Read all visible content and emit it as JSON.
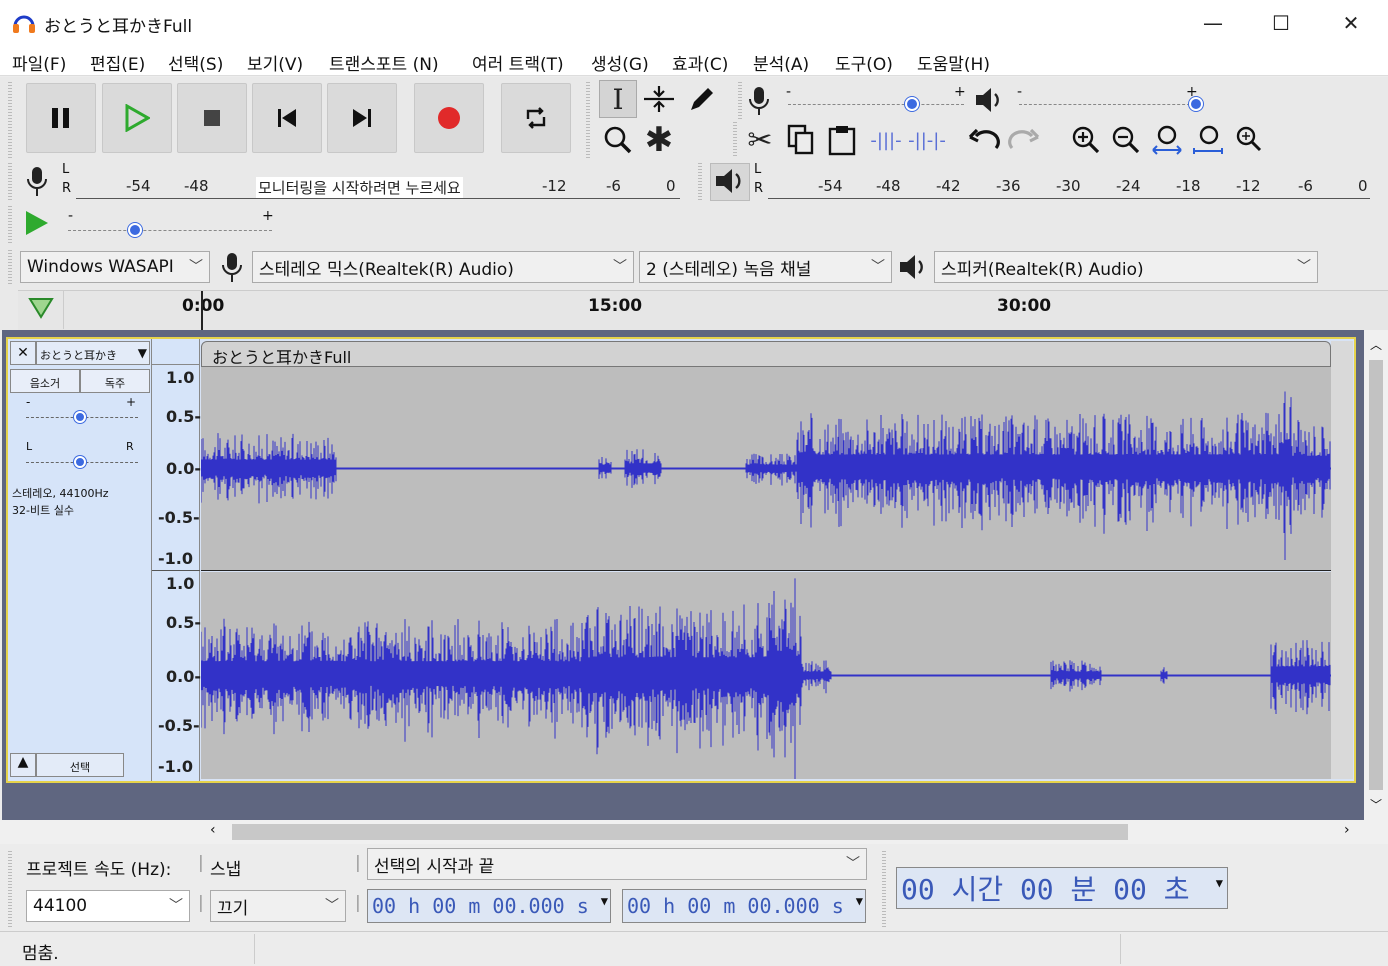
{
  "window": {
    "title": "おとうと耳かきFull",
    "minimize": "—",
    "maximize": "☐",
    "close": "✕"
  },
  "menu": [
    "파일(F)",
    "편집(E)",
    "선택(S)",
    "보기(V)",
    "트랜스포트 (N)",
    "여러 트랙(T)",
    "생성(G)",
    "효과(C)",
    "분석(A)",
    "도구(O)",
    "도움말(H)"
  ],
  "recording_meter": {
    "ticks": [
      "-54",
      "-48",
      "-12",
      "-6",
      "0"
    ],
    "prompt": "모니터링을 시작하려면 누르세요",
    "l": "L",
    "r": "R"
  },
  "playback_meter": {
    "ticks": [
      "-54",
      "-48",
      "-42",
      "-36",
      "-30",
      "-24",
      "-18",
      "-12",
      "-6",
      "0"
    ],
    "l": "L",
    "r": "R"
  },
  "slider_labels": {
    "minus": "-",
    "plus": "+"
  },
  "device": {
    "host": "Windows WASAPI",
    "input": "스테레오 믹스(Realtek(R) Audio)",
    "channels": "2 (스테레오) 녹음 채널",
    "output": "스피커(Realtek(R) Audio)"
  },
  "timeline": {
    "labels": [
      "0:00",
      "15:00",
      "30:00"
    ]
  },
  "track": {
    "name": "おとうと耳かき",
    "clip_title": "おとうと耳かきFull",
    "mute": "음소거",
    "solo": "독주",
    "pan_left": "L",
    "pan_right": "R",
    "info_line1": "스테레오, 44100Hz",
    "info_line2": "32-비트 실수",
    "select": "선택",
    "close": "✕"
  },
  "scale_top": [
    "1.0",
    "0.5-",
    "0.0-",
    "-0.5-",
    "-1.0"
  ],
  "scale_bottom": [
    "1.0",
    "0.5-",
    "0.0-",
    "-0.5-",
    "-1.0"
  ],
  "bottom": {
    "project_rate_label": "프로젝트 속도 (Hz):",
    "snap_label": "스냅",
    "project_rate": "44100",
    "snap": "끄기",
    "selection_mode": "선택의 시작과 끝",
    "sel_start": "00 h 00 m 00.000 s",
    "sel_end": "00 h 00 m 00.000 s",
    "audio_pos": "00 시간 00 분 00 초"
  },
  "status": {
    "text": "멈춤."
  },
  "colors": {
    "waveform": "#3232c8",
    "wave_bg": "#bdbdbd",
    "track_area": "#5f6680",
    "selection_border": "#e6d34b",
    "play_green": "#2eaa2e",
    "record_red": "#e12a2a"
  }
}
